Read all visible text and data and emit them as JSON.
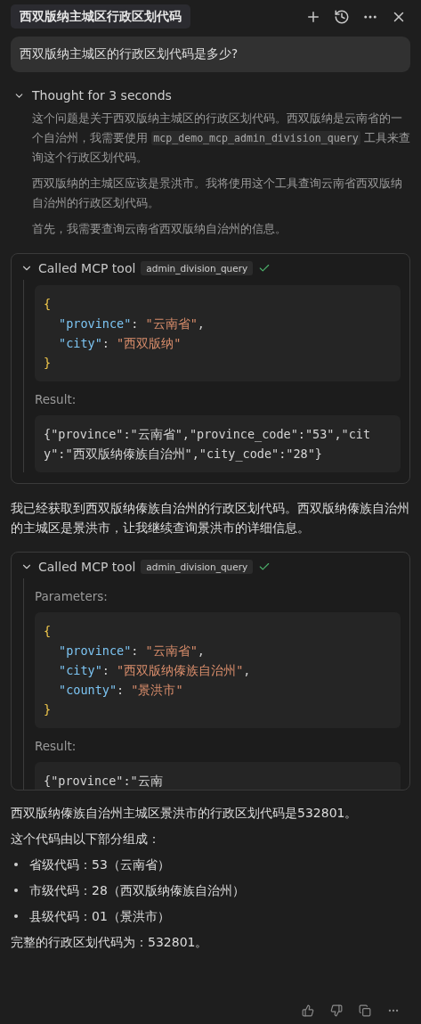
{
  "header": {
    "title": "西双版纳主城区行政区划代码"
  },
  "user_message": "西双版纳主城区的行政区划代码是多少?",
  "transcript": [
    {
      "kind": "thought",
      "label": "Thought for 3 seconds",
      "expanded": true,
      "paragraphs": [
        [
          {
            "kind": "text",
            "t": "这个问题是关于西双版纳主城区的行政区划代码。西双版纳是云南省的一个自治州，我需要使用 "
          },
          {
            "kind": "code",
            "t": "mcp_demo_mcp_admin_division_query"
          },
          {
            "kind": "text",
            "t": " 工具来查询这个行政区划代码。"
          }
        ],
        [
          {
            "kind": "text",
            "t": "西双版纳的主城区应该是景洪市。我将使用这个工具查询云南省西双版纳自治州的行政区划代码。"
          }
        ],
        [
          {
            "kind": "text",
            "t": "首先，我需要查询云南省西双版纳自治州的信息。"
          }
        ]
      ]
    },
    {
      "kind": "tool",
      "label": "Called MCP tool",
      "tool_name": "admin_division_query",
      "expanded": true,
      "success": true,
      "code": [
        {
          "nested": false,
          "tokens": [
            {
              "kind": "brace",
              "t": "{"
            }
          ]
        },
        {
          "nested": true,
          "tokens": [
            {
              "kind": "key",
              "t": "\"province\""
            },
            {
              "kind": "punct",
              "t": ": "
            },
            {
              "kind": "string",
              "t": "\"云南省\""
            },
            {
              "kind": "punct",
              "t": ","
            }
          ]
        },
        {
          "nested": true,
          "tokens": [
            {
              "kind": "key",
              "t": "\"city\""
            },
            {
              "kind": "punct",
              "t": ": "
            },
            {
              "kind": "string",
              "t": "\"西双版纳\""
            }
          ]
        },
        {
          "nested": false,
          "tokens": [
            {
              "kind": "brace",
              "t": "}"
            }
          ]
        }
      ],
      "result_label": "Result:",
      "result": "{\"province\":\"云南省\",\"province_code\":\"53\",\"city\":\"西双版纳傣族自治州\",\"city_code\":\"28\"}"
    },
    {
      "kind": "text",
      "text": "我已经获取到西双版纳傣族自治州的行政区划代码。西双版纳傣族自治州的主城区是景洪市，让我继续查询景洪市的详细信息。"
    },
    {
      "kind": "tool",
      "label": "Called MCP tool",
      "tool_name": "admin_division_query",
      "expanded": true,
      "success": true,
      "parameters_label": "Parameters:",
      "code": [
        {
          "nested": false,
          "tokens": [
            {
              "kind": "brace",
              "t": "{"
            }
          ]
        },
        {
          "nested": true,
          "tokens": [
            {
              "kind": "key",
              "t": "\"province\""
            },
            {
              "kind": "punct",
              "t": ": "
            },
            {
              "kind": "string",
              "t": "\"云南省\""
            },
            {
              "kind": "punct",
              "t": ","
            }
          ]
        },
        {
          "nested": true,
          "tokens": [
            {
              "kind": "key",
              "t": "\"city\""
            },
            {
              "kind": "punct",
              "t": ": "
            },
            {
              "kind": "string",
              "t": "\"西双版纳傣族自治州\""
            },
            {
              "kind": "punct",
              "t": ","
            }
          ]
        },
        {
          "nested": true,
          "tokens": [
            {
              "kind": "key",
              "t": "\"county\""
            },
            {
              "kind": "punct",
              "t": ": "
            },
            {
              "kind": "string",
              "t": "\"景洪市\""
            }
          ]
        },
        {
          "nested": false,
          "tokens": [
            {
              "kind": "brace",
              "t": "}"
            }
          ]
        }
      ],
      "result_label": "Result:",
      "result": "{\"province\":\"云南"
    },
    {
      "kind": "answer",
      "blocks": [
        {
          "kind": "para",
          "text": "西双版纳傣族自治州主城区景洪市的行政区划代码是532801。"
        },
        {
          "kind": "para",
          "text": "这个代码由以下部分组成："
        },
        {
          "kind": "list",
          "items": [
            "省级代码：53（云南省）",
            "市级代码：28（西双版纳傣族自治州）",
            "县级代码：01（景洪市）"
          ]
        },
        {
          "kind": "para",
          "text": "完整的行政区划代码为：532801。"
        }
      ]
    }
  ]
}
